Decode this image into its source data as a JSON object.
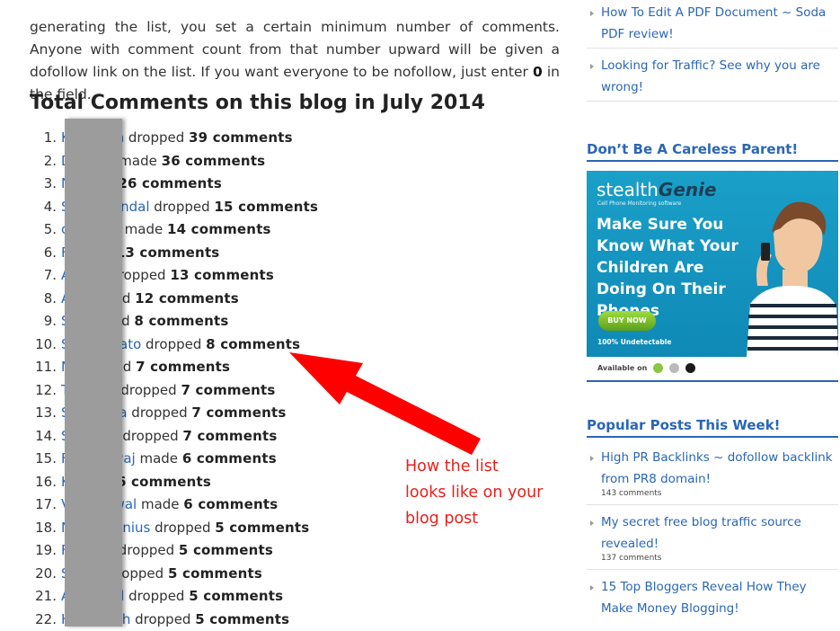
{
  "intro": {
    "text_before_bold": "generating the list, you set a certain minimum number of comments.  Anyone with comment count from that number upward will be given a dofollow link on the list. If you want everyone to be nofollow, just enter ",
    "bold_value": "0",
    "text_after_bold": " in the field."
  },
  "section_title": "Total Comments on this blog in July 2014",
  "comments": [
    {
      "num": "1.",
      "name": "K     ncan",
      "verb": " dropped ",
      "count": "39 comments"
    },
    {
      "num": "2.",
      "name": "D     um",
      "verb": " made ",
      "count": "36 comments"
    },
    {
      "num": "3.",
      "name": "N",
      "verb": " made ",
      "count": "26 comments"
    },
    {
      "num": "4.",
      "name": "S     t Mondal",
      "verb": " dropped ",
      "count": "15 comments"
    },
    {
      "num": "5.",
      "name": "c     errill",
      "verb": " made ",
      "count": "14 comments"
    },
    {
      "num": "6.",
      "name": "F",
      "verb": " made ",
      "count": "13 comments"
    },
    {
      "num": "7.",
      "name": "A     ar",
      "verb": " dropped ",
      "count": "13 comments"
    },
    {
      "num": "8.",
      "name": "A",
      "verb": " dropped ",
      "count": "12 comments"
    },
    {
      "num": "9.",
      "name": "S",
      "verb": " dropped ",
      "count": "8 comments"
    },
    {
      "num": "10.",
      "name": "S     Mahato",
      "verb": " dropped ",
      "count": "8 comments"
    },
    {
      "num": "11.",
      "name": "N",
      "verb": " dropped ",
      "count": "7 comments"
    },
    {
      "num": "12.",
      "name": "T     Das",
      "verb": " dropped ",
      "count": "7 comments"
    },
    {
      "num": "13.",
      "name": "S     yinka",
      "verb": " dropped ",
      "count": "7 comments"
    },
    {
      "num": "14.",
      "name": "S     erry",
      "verb": " dropped ",
      "count": "7 comments"
    },
    {
      "num": "15.",
      "name": "F     ardwaj",
      "verb": " made ",
      "count": "6 comments"
    },
    {
      "num": "16.",
      "name": "K",
      "verb": " made ",
      "count": "6 comments"
    },
    {
      "num": "17.",
      "name": "V     Varwal",
      "verb": " made ",
      "count": "6 comments"
    },
    {
      "num": "18.",
      "name": "N     hmanius",
      "verb": " dropped ",
      "count": "5 comments"
    },
    {
      "num": "19.",
      "name": "F     esh",
      "verb": " dropped ",
      "count": "5 comments"
    },
    {
      "num": "20.",
      "name": "S     id",
      "verb": " dropped ",
      "count": "5 comments"
    },
    {
      "num": "21.",
      "name": "A     cCall",
      "verb": " dropped ",
      "count": "5 comments"
    },
    {
      "num": "22.",
      "name": "H     Singh",
      "verb": " dropped ",
      "count": "5 comments"
    }
  ],
  "annotation": {
    "line1": "How the list",
    "line2": "looks like on your",
    "line3": "blog post",
    "color": "#e8201b"
  },
  "sidebar": {
    "recent_posts": [
      {
        "title": "How To Edit A PDF Document ~ Soda PDF review!"
      },
      {
        "title": "Looking for Traffic? See why you are wrong!"
      }
    ],
    "ad_widget_title": "Don’t Be A Careless Parent!",
    "ad": {
      "brand_plain": "stealth",
      "brand_italic": "Genie",
      "brand_sub": "Cell Phone Monitoring software",
      "headline": "Make Sure You Know What Your Children Are Doing On Their Phones",
      "button": "BUY NOW",
      "small": "100% Undetectable",
      "available": "Available on"
    },
    "popular_title": "Popular Posts This Week!",
    "popular_posts": [
      {
        "title": "High PR Backlinks ~ dofollow backlink from PR8 domain!",
        "meta": "143 comments"
      },
      {
        "title": "My secret free blog traffic source revealed!",
        "meta": "137 comments"
      },
      {
        "title": "15 Top Bloggers Reveal How They Make Money Blogging!",
        "meta": ""
      }
    ],
    "accent_color": "#2a66b5"
  }
}
